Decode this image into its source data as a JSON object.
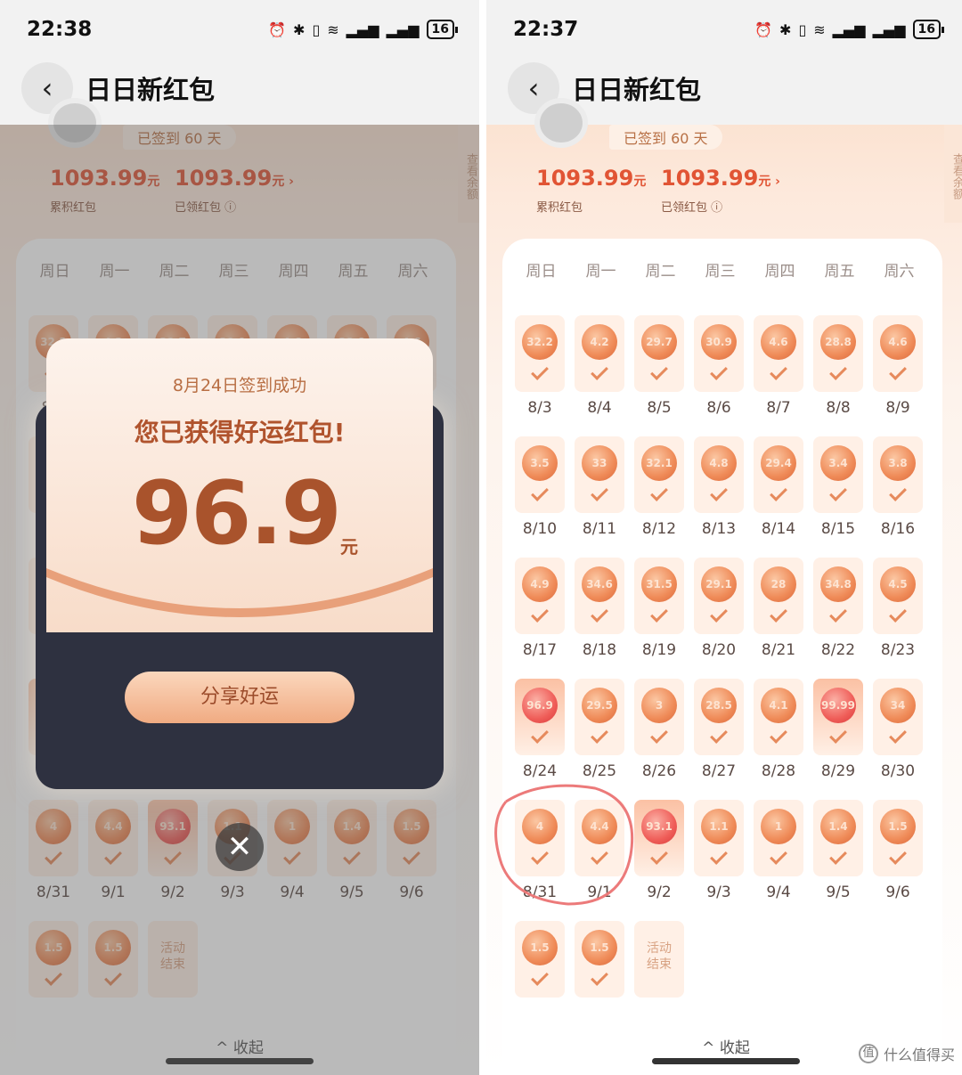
{
  "left": {
    "time": "22:38"
  },
  "right": {
    "time": "22:37"
  },
  "status": {
    "battery": "16"
  },
  "app": {
    "title": "日日新红包"
  },
  "summary": {
    "streak": "已签到 60 天",
    "total_amount": "1093.99",
    "total_unit": "元",
    "total_label": "累积红包",
    "claimed_amount": "1093.99",
    "claimed_unit": "元 ›",
    "claimed_label": "已领红包 ⓘ",
    "side_tab": "查看余额"
  },
  "weekdays": [
    "周日",
    "周一",
    "周二",
    "周三",
    "周四",
    "周五",
    "周六"
  ],
  "days": [
    {
      "date": "8/3",
      "value": "32.2"
    },
    {
      "date": "8/4",
      "value": "4.2"
    },
    {
      "date": "8/5",
      "value": "29.7"
    },
    {
      "date": "8/6",
      "value": "30.9"
    },
    {
      "date": "8/7",
      "value": "4.6"
    },
    {
      "date": "8/8",
      "value": "28.8"
    },
    {
      "date": "8/9",
      "value": "4.6"
    },
    {
      "date": "8/10",
      "value": "3.5"
    },
    {
      "date": "8/11",
      "value": "33"
    },
    {
      "date": "8/12",
      "value": "32.1"
    },
    {
      "date": "8/13",
      "value": "4.8"
    },
    {
      "date": "8/14",
      "value": "29.4"
    },
    {
      "date": "8/15",
      "value": "3.4"
    },
    {
      "date": "8/16",
      "value": "3.8"
    },
    {
      "date": "8/17",
      "value": "4.9"
    },
    {
      "date": "8/18",
      "value": "34.6"
    },
    {
      "date": "8/19",
      "value": "31.5"
    },
    {
      "date": "8/20",
      "value": "29.1"
    },
    {
      "date": "8/21",
      "value": "28"
    },
    {
      "date": "8/22",
      "value": "34.8"
    },
    {
      "date": "8/23",
      "value": "4.5"
    },
    {
      "date": "8/24",
      "value": "96.9",
      "highlight": true
    },
    {
      "date": "8/25",
      "value": "29.5"
    },
    {
      "date": "8/26",
      "value": "3"
    },
    {
      "date": "8/27",
      "value": "28.5"
    },
    {
      "date": "8/28",
      "value": "4.1"
    },
    {
      "date": "8/29",
      "value": "99.99",
      "highlight": true
    },
    {
      "date": "8/30",
      "value": "34"
    },
    {
      "date": "8/31",
      "value": "4"
    },
    {
      "date": "9/1",
      "value": "4.4"
    },
    {
      "date": "9/2",
      "value": "93.1",
      "highlight": true
    },
    {
      "date": "9/3",
      "value": "1.1"
    },
    {
      "date": "9/4",
      "value": "1"
    },
    {
      "date": "9/5",
      "value": "1.4"
    },
    {
      "date": "9/6",
      "value": "1.5"
    },
    {
      "date": "",
      "value": "1.5"
    },
    {
      "date": "",
      "value": "1.5"
    }
  ],
  "activity_end": "活动\n结束",
  "collapse_label": "^ 收起",
  "modal": {
    "subtitle": "8月24日签到成功",
    "heading": "您已获得好运红包!",
    "amount": "96.9",
    "unit": "元",
    "share_label": "分享好运",
    "close": "✕"
  },
  "watermark": {
    "logo": "值",
    "text": "什么值得买"
  }
}
